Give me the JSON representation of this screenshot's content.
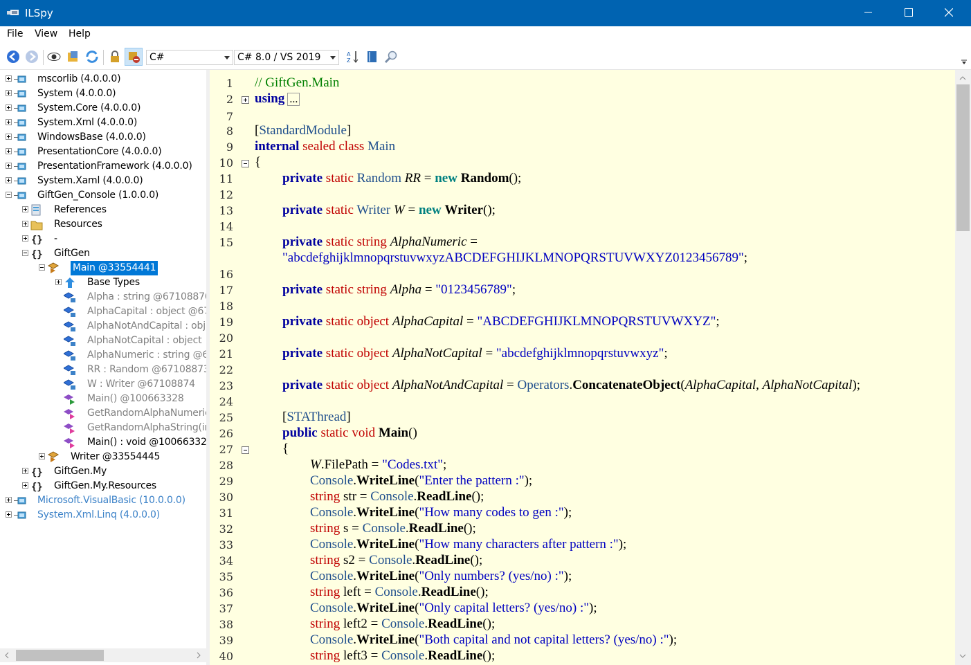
{
  "window": {
    "title": "ILSpy"
  },
  "menu": [
    "File",
    "View",
    "Help"
  ],
  "toolbar": {
    "language": "C#",
    "version": "C# 8.0 / VS 2019"
  },
  "tree": [
    {
      "label": "mscorlib (4.0.0.0)"
    },
    {
      "label": "System (4.0.0.0)"
    },
    {
      "label": "System.Core (4.0.0.0)"
    },
    {
      "label": "System.Xml (4.0.0.0)"
    },
    {
      "label": "WindowsBase (4.0.0.0)"
    },
    {
      "label": "PresentationCore (4.0.0.0)"
    },
    {
      "label": "PresentationFramework (4.0.0.0)"
    },
    {
      "label": "System.Xaml (4.0.0.0)"
    },
    {
      "label": "GiftGen_Console (1.0.0.0)"
    },
    {
      "label": "References"
    },
    {
      "label": "Resources"
    },
    {
      "label": "-"
    },
    {
      "label": "GiftGen"
    },
    {
      "label": "Main @33554441"
    },
    {
      "label": "Base Types"
    },
    {
      "label": "Alpha : string @67108876"
    },
    {
      "label": "AlphaCapital : object @67"
    },
    {
      "label": "AlphaNotAndCapital : obj"
    },
    {
      "label": "AlphaNotCapital : object"
    },
    {
      "label": "AlphaNumeric : string @6"
    },
    {
      "label": "RR : Random @67108873"
    },
    {
      "label": "W : Writer @67108874"
    },
    {
      "label": "Main() @100663328"
    },
    {
      "label": "GetRandomAlphaNumeric"
    },
    {
      "label": "GetRandomAlphaString(ir"
    },
    {
      "label": "Main() : void @10066332"
    },
    {
      "label": "Writer @33554445"
    },
    {
      "label": "GiftGen.My"
    },
    {
      "label": "GiftGen.My.Resources"
    },
    {
      "label": "Microsoft.VisualBasic (10.0.0.0)"
    },
    {
      "label": "System.Xml.Linq (4.0.0.0)"
    }
  ],
  "code": {
    "line_numbers": [
      "1",
      "2",
      "7",
      "8",
      "9",
      "10",
      "11",
      "12",
      "13",
      "14",
      "15",
      "16",
      "17",
      "18",
      "19",
      "20",
      "21",
      "22",
      "23",
      "24",
      "25",
      "26",
      "27",
      "28",
      "29",
      "30",
      "31",
      "32",
      "33",
      "34",
      "35",
      "36",
      "37",
      "38",
      "39",
      "40"
    ],
    "lines": [
      [
        [
          "c",
          "// GiftGen.Main"
        ]
      ],
      [
        [
          "k",
          "using"
        ]
      ],
      [],
      [
        [
          "",
          "["
        ],
        [
          "t",
          "StandardModule"
        ],
        [
          "",
          "]"
        ]
      ],
      [
        [
          "k",
          "internal"
        ],
        [
          "",
          " "
        ],
        [
          "m",
          "sealed"
        ],
        [
          "",
          " "
        ],
        [
          "m",
          "class"
        ],
        [
          "",
          " "
        ],
        [
          "t",
          "Main"
        ]
      ],
      [
        [
          "",
          "{"
        ]
      ],
      [
        [
          "k",
          "private"
        ],
        [
          "",
          " "
        ],
        [
          "m",
          "static"
        ],
        [
          "",
          " "
        ],
        [
          "t",
          "Random"
        ],
        [
          "",
          " "
        ],
        [
          "i",
          "RR"
        ],
        [
          "",
          " = "
        ],
        [
          "nw",
          "new"
        ],
        [
          "",
          " "
        ],
        [
          "b",
          "Random"
        ],
        [
          "",
          "();"
        ]
      ],
      [],
      [
        [
          "k",
          "private"
        ],
        [
          "",
          " "
        ],
        [
          "m",
          "static"
        ],
        [
          "",
          " "
        ],
        [
          "t",
          "Writer"
        ],
        [
          "",
          " "
        ],
        [
          "i",
          "W"
        ],
        [
          "",
          " = "
        ],
        [
          "nw",
          "new"
        ],
        [
          "",
          " "
        ],
        [
          "b",
          "Writer"
        ],
        [
          "",
          "();"
        ]
      ],
      [],
      [
        [
          "k",
          "private"
        ],
        [
          "",
          " "
        ],
        [
          "m",
          "static"
        ],
        [
          "",
          " "
        ],
        [
          "m",
          "string"
        ],
        [
          "",
          " "
        ],
        [
          "i",
          "AlphaNumeric"
        ],
        [
          "",
          " ="
        ]
      ],
      [
        [
          "s",
          "\"abcdefghijklmnopqrstuvwxyzABCDEFGHIJKLMNOPQRSTUVWXYZ0123456789\""
        ],
        [
          "",
          ";"
        ]
      ],
      [
        [
          "k",
          "private"
        ],
        [
          "",
          " "
        ],
        [
          "m",
          "static"
        ],
        [
          "",
          " "
        ],
        [
          "m",
          "string"
        ],
        [
          "",
          " "
        ],
        [
          "i",
          "Alpha"
        ],
        [
          "",
          " = "
        ],
        [
          "s",
          "\"0123456789\""
        ],
        [
          "",
          ";"
        ]
      ],
      [],
      [
        [
          "k",
          "private"
        ],
        [
          "",
          " "
        ],
        [
          "m",
          "static"
        ],
        [
          "",
          " "
        ],
        [
          "m",
          "object"
        ],
        [
          "",
          " "
        ],
        [
          "i",
          "AlphaCapital"
        ],
        [
          "",
          " = "
        ],
        [
          "s",
          "\"ABCDEFGHIJKLMNOPQRSTUVWXYZ\""
        ],
        [
          "",
          ";"
        ]
      ],
      [],
      [
        [
          "k",
          "private"
        ],
        [
          "",
          " "
        ],
        [
          "m",
          "static"
        ],
        [
          "",
          " "
        ],
        [
          "m",
          "object"
        ],
        [
          "",
          " "
        ],
        [
          "i",
          "AlphaNotCapital"
        ],
        [
          "",
          " = "
        ],
        [
          "s",
          "\"abcdefghijklmnopqrstuvwxyz\""
        ],
        [
          "",
          ";"
        ]
      ],
      [],
      [
        [
          "k",
          "private"
        ],
        [
          "",
          " "
        ],
        [
          "m",
          "static"
        ],
        [
          "",
          " "
        ],
        [
          "m",
          "object"
        ],
        [
          "",
          " "
        ],
        [
          "i",
          "AlphaNotAndCapital"
        ],
        [
          "",
          " = "
        ],
        [
          "t",
          "Operators"
        ],
        [
          "",
          "."
        ],
        [
          "b",
          "ConcatenateObject"
        ],
        [
          "",
          "("
        ],
        [
          "i",
          "AlphaCapital"
        ],
        [
          "",
          ", "
        ],
        [
          "i",
          "AlphaNotCapital"
        ],
        [
          "",
          ");"
        ]
      ],
      [],
      [
        [
          "",
          "["
        ],
        [
          "t",
          "STAThread"
        ],
        [
          "",
          "]"
        ]
      ],
      [
        [
          "k",
          "public"
        ],
        [
          "",
          " "
        ],
        [
          "m",
          "static"
        ],
        [
          "",
          " "
        ],
        [
          "m",
          "void"
        ],
        [
          "",
          " "
        ],
        [
          "b",
          "Main"
        ],
        [
          "",
          "()"
        ]
      ],
      [
        [
          "",
          "{"
        ]
      ],
      [
        [
          "i",
          "W"
        ],
        [
          "",
          ".FilePath = "
        ],
        [
          "s",
          "\"Codes.txt\""
        ],
        [
          "",
          ";"
        ]
      ],
      [
        [
          "t",
          "Console"
        ],
        [
          "",
          "."
        ],
        [
          "b",
          "WriteLine"
        ],
        [
          "",
          "("
        ],
        [
          "s",
          "\"Enter the pattern :\""
        ],
        [
          "",
          ");"
        ]
      ],
      [
        [
          "m",
          "string"
        ],
        [
          "",
          " str = "
        ],
        [
          "t",
          "Console"
        ],
        [
          "",
          "."
        ],
        [
          "b",
          "ReadLine"
        ],
        [
          "",
          "();"
        ]
      ],
      [
        [
          "t",
          "Console"
        ],
        [
          "",
          "."
        ],
        [
          "b",
          "WriteLine"
        ],
        [
          "",
          "("
        ],
        [
          "s",
          "\"How many codes to gen :\""
        ],
        [
          "",
          ");"
        ]
      ],
      [
        [
          "m",
          "string"
        ],
        [
          "",
          " s = "
        ],
        [
          "t",
          "Console"
        ],
        [
          "",
          "."
        ],
        [
          "b",
          "ReadLine"
        ],
        [
          "",
          "();"
        ]
      ],
      [
        [
          "t",
          "Console"
        ],
        [
          "",
          "."
        ],
        [
          "b",
          "WriteLine"
        ],
        [
          "",
          "("
        ],
        [
          "s",
          "\"How many characters after pattern :\""
        ],
        [
          "",
          ");"
        ]
      ],
      [
        [
          "m",
          "string"
        ],
        [
          "",
          " s2 = "
        ],
        [
          "t",
          "Console"
        ],
        [
          "",
          "."
        ],
        [
          "b",
          "ReadLine"
        ],
        [
          "",
          "();"
        ]
      ],
      [
        [
          "t",
          "Console"
        ],
        [
          "",
          "."
        ],
        [
          "b",
          "WriteLine"
        ],
        [
          "",
          "("
        ],
        [
          "s",
          "\"Only numbers? (yes/no) :\""
        ],
        [
          "",
          ");"
        ]
      ],
      [
        [
          "m",
          "string"
        ],
        [
          "",
          " left = "
        ],
        [
          "t",
          "Console"
        ],
        [
          "",
          "."
        ],
        [
          "b",
          "ReadLine"
        ],
        [
          "",
          "();"
        ]
      ],
      [
        [
          "t",
          "Console"
        ],
        [
          "",
          "."
        ],
        [
          "b",
          "WriteLine"
        ],
        [
          "",
          "("
        ],
        [
          "s",
          "\"Only capital letters? (yes/no) :\""
        ],
        [
          "",
          ");"
        ]
      ],
      [
        [
          "m",
          "string"
        ],
        [
          "",
          " left2 = "
        ],
        [
          "t",
          "Console"
        ],
        [
          "",
          "."
        ],
        [
          "b",
          "ReadLine"
        ],
        [
          "",
          "();"
        ]
      ],
      [
        [
          "t",
          "Console"
        ],
        [
          "",
          "."
        ],
        [
          "b",
          "WriteLine"
        ],
        [
          "",
          "("
        ],
        [
          "s",
          "\"Both capital and not capital letters? (yes/no) :\""
        ],
        [
          "",
          ");"
        ]
      ],
      [
        [
          "m",
          "string"
        ],
        [
          "",
          " left3 = "
        ],
        [
          "t",
          "Console"
        ],
        [
          "",
          "."
        ],
        [
          "b",
          "ReadLine"
        ],
        [
          "",
          "();"
        ]
      ]
    ],
    "ellipsis": "..."
  }
}
